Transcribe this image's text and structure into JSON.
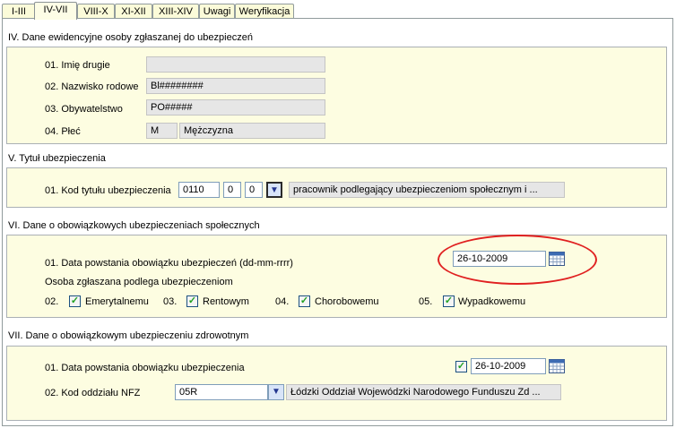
{
  "tabs": [
    {
      "label": "I-III"
    },
    {
      "label": "IV-VII"
    },
    {
      "label": "VIII-X"
    },
    {
      "label": "XI-XII"
    },
    {
      "label": "XIII-XIV"
    },
    {
      "label": "Uwagi"
    },
    {
      "label": "Weryfikacja"
    }
  ],
  "active_tab": "IV-VII",
  "sec4": {
    "title": "IV. Dane ewidencyjne osoby zgłaszanej do ubezpieczeń",
    "imie_label": "01. Imię drugie",
    "imie_value": "",
    "nazwisko_label": "02. Nazwisko rodowe",
    "nazwisko_value": "Bl########",
    "obyw_label": "03. Obywatelstwo",
    "obyw_value": "PO#####",
    "plec_label": "04. Płeć",
    "plec_code": "M",
    "plec_text": "Mężczyzna"
  },
  "sec5": {
    "title": "V. Tytuł ubezpieczenia",
    "kod_label": "01. Kod tytułu ubezpieczenia",
    "kod1": "0110",
    "kod2": "0",
    "kod3": "0",
    "kod_desc": "pracownik podlegający ubezpieczeniom społecznym i  ..."
  },
  "sec6": {
    "title": "VI. Dane o obowiązkowych ubezpieczeniach społecznych",
    "data_label": "01. Data powstania obowiązku ubezpieczeń (dd-mm-rrrr)",
    "data_value": "26-10-2009",
    "osoba_label": "Osoba zgłaszana podlega ubezpieczeniom",
    "items": [
      {
        "num": "02.",
        "label": "Emerytalnemu",
        "checked": true
      },
      {
        "num": "03.",
        "label": "Rentowym",
        "checked": true
      },
      {
        "num": "04.",
        "label": "Chorobowemu",
        "checked": true
      },
      {
        "num": "05.",
        "label": "Wypadkowemu",
        "checked": true
      }
    ]
  },
  "sec7": {
    "title": "VII. Dane o obowiązkowym ubezpieczeniu zdrowotnym",
    "data_label": "01. Data powstania obowiązku ubezpieczenia",
    "data_checked": true,
    "data_value": "26-10-2009",
    "nfz_label": "02. Kod oddziału NFZ",
    "nfz_code": "05R",
    "nfz_desc": "Łódzki Oddział Wojewódzki Narodowego Funduszu Zd ..."
  },
  "colors": {
    "group_bg": "#fdfde1",
    "tab_bg": "#fbfbd9",
    "highlight": "#e02020",
    "check": "#21a121"
  }
}
